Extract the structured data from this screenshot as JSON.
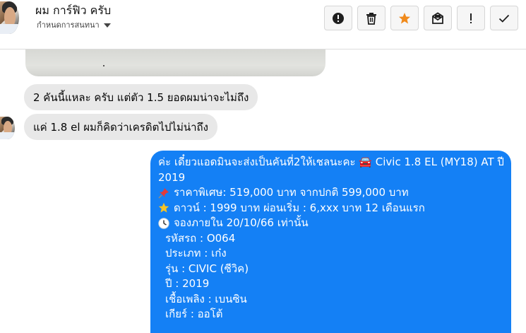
{
  "header": {
    "name": "ผม การ์ฟิว ครับ",
    "subtitle": "กำหนดการสนทนา",
    "actions": [
      {
        "label": "Report",
        "icon": "alert-circle-icon"
      },
      {
        "label": "Delete",
        "icon": "trash-icon"
      },
      {
        "label": "Star",
        "icon": "star-icon"
      },
      {
        "label": "Mark unread",
        "icon": "envelope-icon"
      },
      {
        "label": "Important",
        "icon": "exclamation-icon"
      },
      {
        "label": "Done",
        "icon": "check-icon"
      }
    ]
  },
  "messages": {
    "in_1": "2 คันนี้แหละ ครับ แต่ตัว 1.5 ยอดผมน่าจะไม่ถึง",
    "in_2": "แค่ 1.8 el ผมก็คิดว่าเครดิตไปไม่น่าถึง",
    "out": {
      "line1": "ค่ะ เดี๋ยวแอดมินจะส่งเป็นคันที่2ให้เชลนะคะ  🚘 Civic 1.8 EL (MY18) AT ปี",
      "line2": "2019",
      "price": "ราคาพิเศษ: 519,000 บาท จากปกติ 599,000 บาท",
      "down": "ดาวน์ : 1999 บาท ผ่อนเริ่ม : 6,xxx บาท 12 เดือนแรก",
      "booking": "จองภายใน 20/10/66 เท่านั้น",
      "code": "รหัสรถ : O064",
      "type": "ประเภท : เก๋ง",
      "model": "รุ่น : CIVIC (ซีวิค)",
      "year": "ปี : 2019",
      "fuel": "เชื้อเพลิง : เบนซิน",
      "gear": "เกียร์ : ออโต้"
    }
  },
  "colors": {
    "outgoing_bubble": "#1480f5",
    "incoming_bubble": "#e8e8e8",
    "star": "#f08a1c"
  }
}
